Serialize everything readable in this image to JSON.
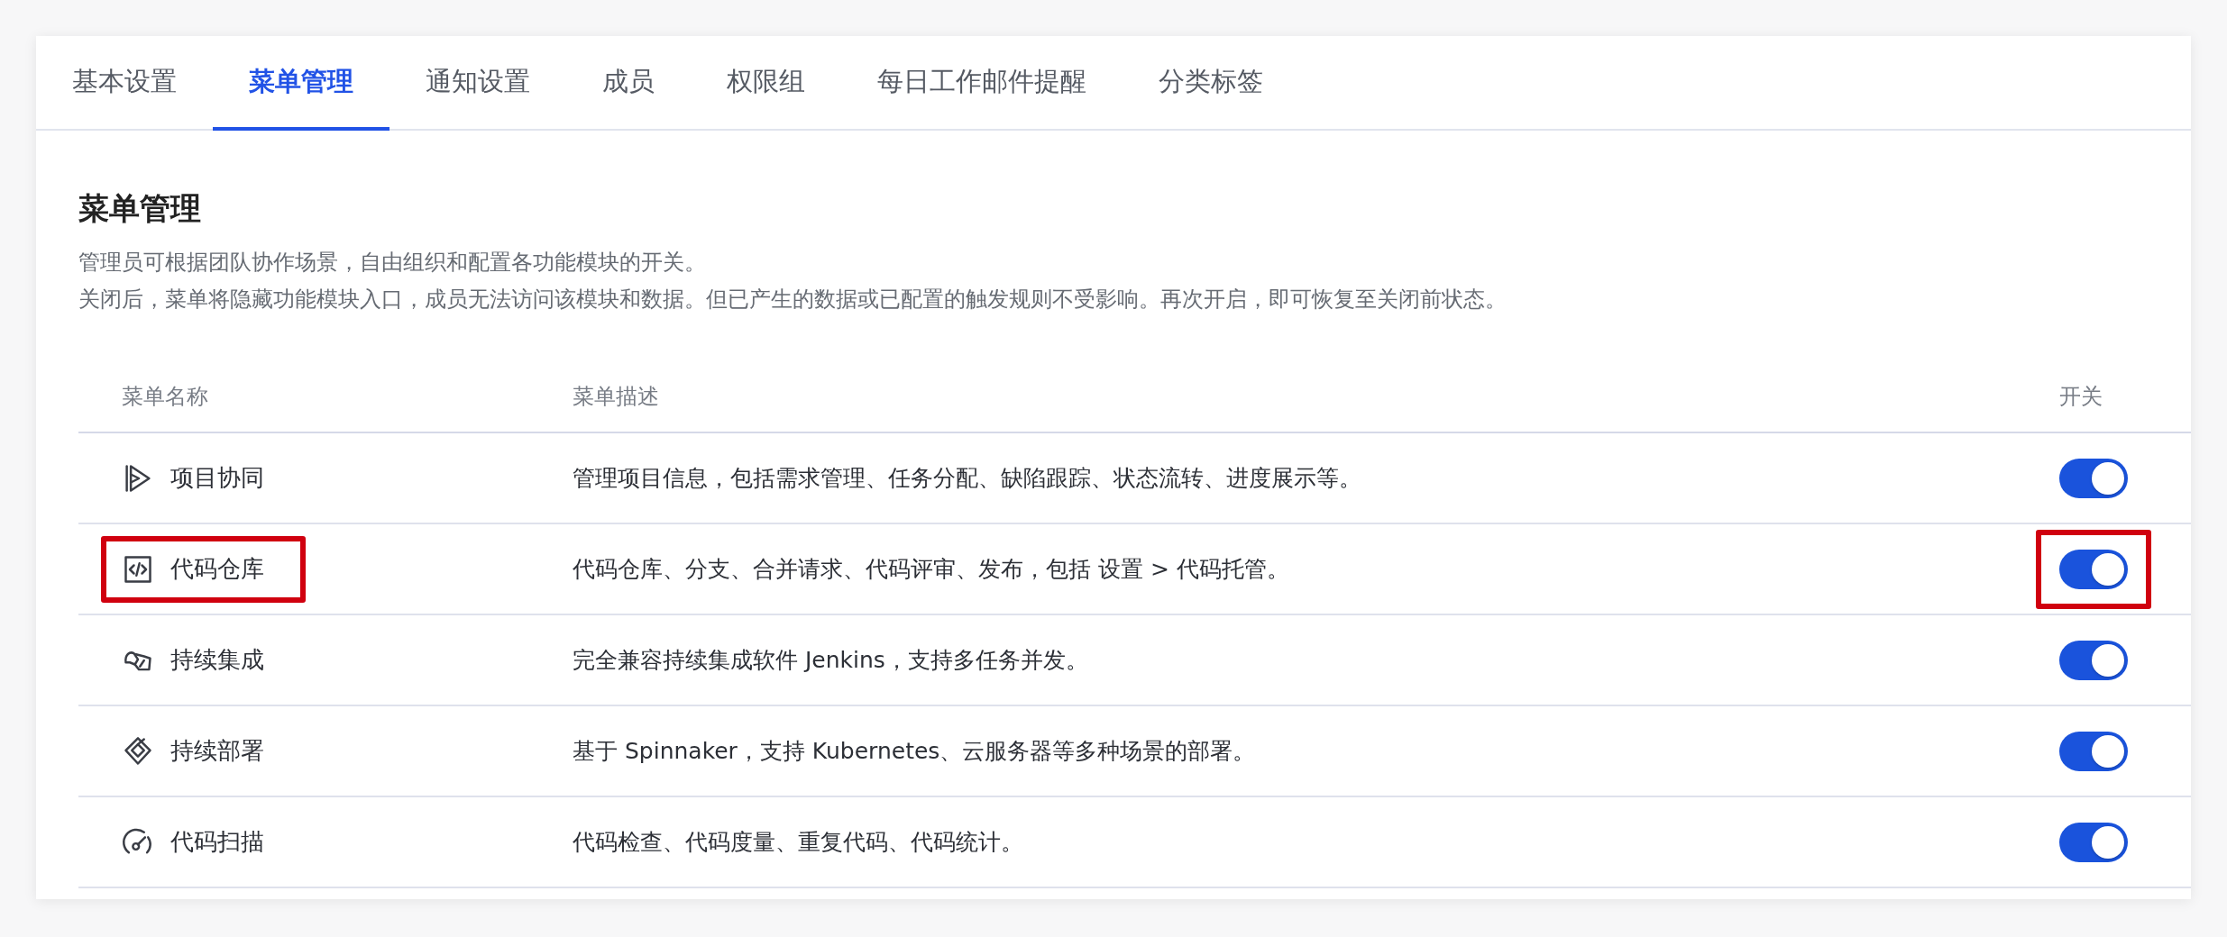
{
  "tabs": [
    {
      "label": "基本设置",
      "selected": false
    },
    {
      "label": "菜单管理",
      "selected": true
    },
    {
      "label": "通知设置",
      "selected": false
    },
    {
      "label": "成员",
      "selected": false
    },
    {
      "label": "权限组",
      "selected": false
    },
    {
      "label": "每日工作邮件提醒",
      "selected": false
    },
    {
      "label": "分类标签",
      "selected": false
    }
  ],
  "section": {
    "title": "菜单管理",
    "description": [
      "管理员可根据团队协作场景，自由组织和配置各功能模块的开关。",
      "关闭后，菜单将隐藏功能模块入口，成员无法访问该模块和数据。但已产生的数据或已配置的触发规则不受影响。再次开启，即可恢复至关闭前状态。"
    ]
  },
  "table": {
    "columns": [
      "菜单名称",
      "菜单描述",
      "开关"
    ],
    "rows": [
      {
        "name": "项目协同",
        "description": "管理项目信息，包括需求管理、任务分配、缺陷跟踪、状态流转、进度展示等。",
        "on": true,
        "highlighted": false
      },
      {
        "name": "代码仓库",
        "description": "代码仓库、分支、合并请求、代码评审、发布，包括 设置 > 代码托管。",
        "on": true,
        "highlighted": true
      },
      {
        "name": "持续集成",
        "description": "完全兼容持续集成软件 Jenkins，支持多任务并发。",
        "on": true,
        "highlighted": false
      },
      {
        "name": "持续部署",
        "description": "基于 Spinnaker，支持 Kubernetes、云服务器等多种场景的部署。",
        "on": true,
        "highlighted": false
      },
      {
        "name": "代码扫描",
        "description": "代码检查、代码度量、重复代码、代码统计。",
        "on": true,
        "highlighted": false
      }
    ]
  }
}
